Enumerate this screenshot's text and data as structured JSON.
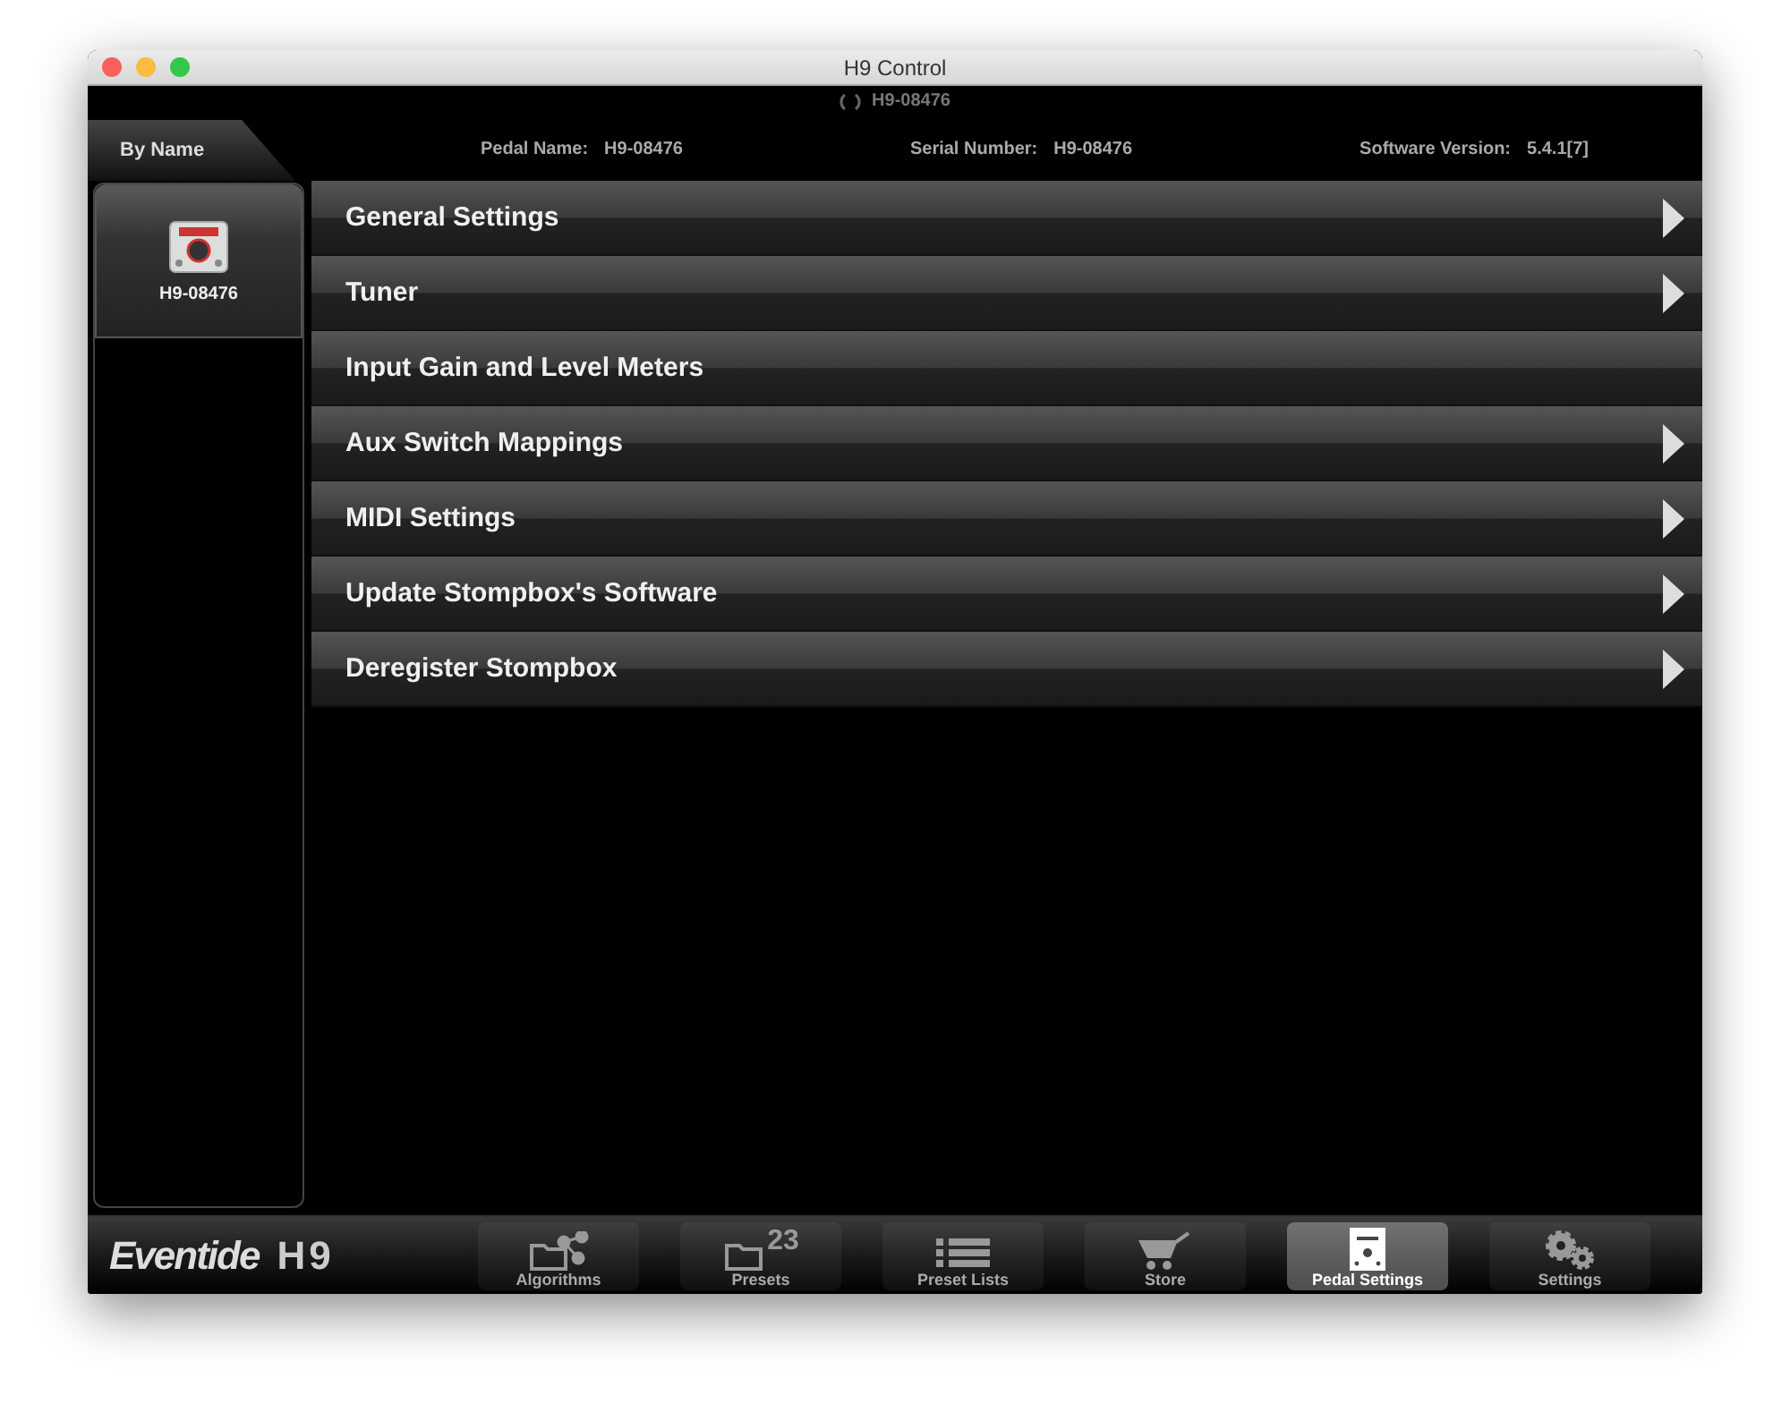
{
  "window": {
    "title": "H9 Control"
  },
  "device_status": {
    "name": "H9-08476"
  },
  "sidebar": {
    "tab": "By Name",
    "devices": [
      {
        "name": "H9-08476",
        "selected": true
      }
    ]
  },
  "info": [
    {
      "label": "Pedal Name:",
      "value": "H9-08476"
    },
    {
      "label": "Serial Number:",
      "value": "H9-08476"
    },
    {
      "label": "Software Version:",
      "value": "5.4.1[7]"
    }
  ],
  "menu": [
    {
      "label": "General Settings",
      "has_arrow": true
    },
    {
      "label": "Tuner",
      "has_arrow": true
    },
    {
      "label": "Input Gain and Level Meters",
      "has_arrow": false
    },
    {
      "label": "Aux Switch Mappings",
      "has_arrow": true
    },
    {
      "label": "MIDI Settings",
      "has_arrow": true
    },
    {
      "label": "Update Stompbox's Software",
      "has_arrow": true
    },
    {
      "label": "Deregister Stompbox",
      "has_arrow": true
    }
  ],
  "logo": {
    "brand": "Eventide",
    "model": "H9"
  },
  "tabs": [
    {
      "label": "Algorithms",
      "kind": "algorithms",
      "selected": false
    },
    {
      "label": "Presets",
      "kind": "presets",
      "badge": "23",
      "selected": false
    },
    {
      "label": "Preset Lists",
      "kind": "list",
      "selected": false
    },
    {
      "label": "Store",
      "kind": "cart",
      "selected": false
    },
    {
      "label": "Pedal Settings",
      "kind": "pedal",
      "selected": true
    },
    {
      "label": "Settings",
      "kind": "gears",
      "selected": false
    }
  ]
}
